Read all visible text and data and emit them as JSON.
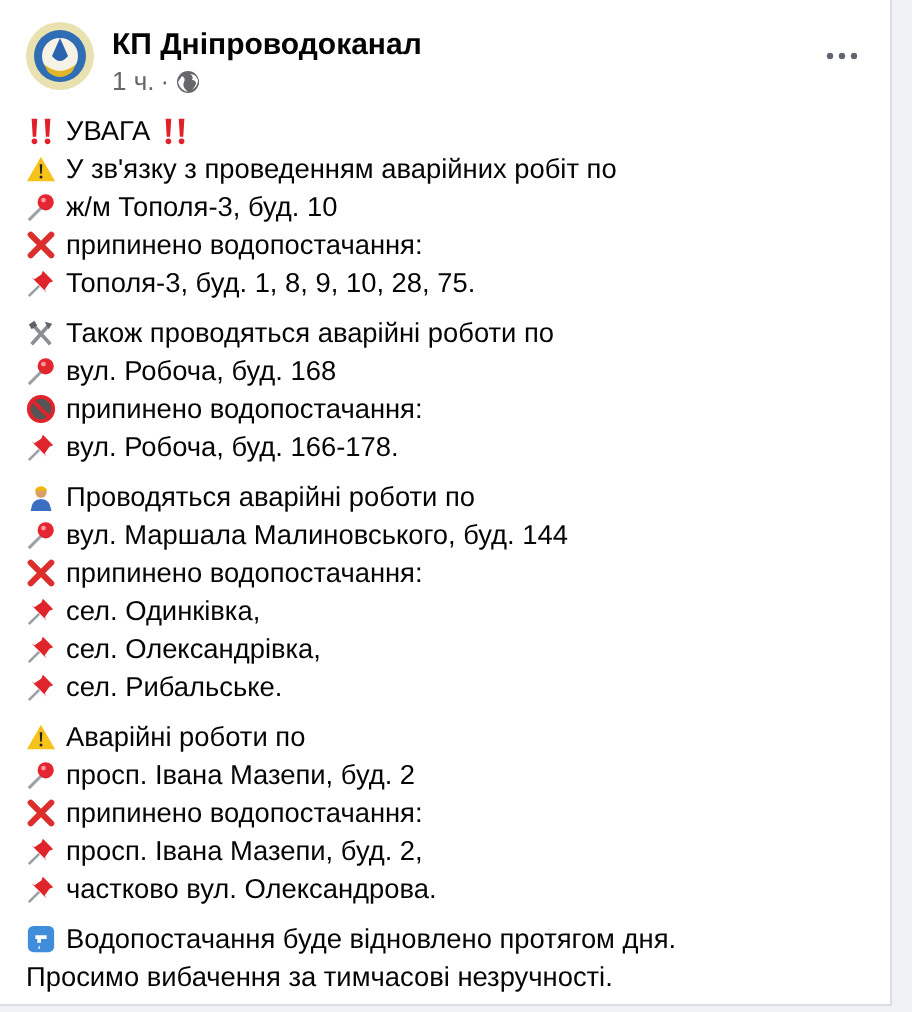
{
  "post": {
    "author": "КП Дніпроводоканал",
    "time": "1 ч.",
    "separator": "·"
  },
  "paragraphs": [
    {
      "lines": [
        {
          "kind": "alert",
          "text": "УВАГА"
        },
        {
          "kind": "warning",
          "text": "У зв'язку з проведенням аварійних робіт по"
        },
        {
          "kind": "location",
          "text": "ж/м Тополя-3, буд. 10"
        },
        {
          "kind": "stopped",
          "text": "припинено водопостачання:"
        },
        {
          "kind": "address",
          "text": "Тополя-3, буд. 1, 8, 9, 10, 28, 75."
        }
      ]
    },
    {
      "lines": [
        {
          "kind": "tools",
          "text": "Також проводяться аварійні роботи по"
        },
        {
          "kind": "location",
          "text": "вул. Робоча, буд. 168"
        },
        {
          "kind": "prohibited",
          "text": "припинено водопостачання:"
        },
        {
          "kind": "address",
          "text": "вул. Робоча, буд. 166-178."
        }
      ]
    },
    {
      "lines": [
        {
          "kind": "worker",
          "text": "Проводяться аварійні роботи по"
        },
        {
          "kind": "location",
          "text": "вул. Маршала Малиновського, буд. 144"
        },
        {
          "kind": "stopped",
          "text": "припинено водопостачання:"
        },
        {
          "kind": "address",
          "text": "сел. Одинківка,"
        },
        {
          "kind": "address",
          "text": "сел. Олександрівка,"
        },
        {
          "kind": "address",
          "text": "сел. Рибальське."
        }
      ]
    },
    {
      "lines": [
        {
          "kind": "warning",
          "text": "Аварійні роботи по"
        },
        {
          "kind": "location",
          "text": "просп. Івана Мазепи, буд. 2"
        },
        {
          "kind": "stopped",
          "text": "припинено водопостачання:"
        },
        {
          "kind": "address",
          "text": "просп. Івана Мазепи, буд. 2,"
        },
        {
          "kind": "address",
          "text": "частково вул. Олександрова."
        }
      ]
    },
    {
      "lines": [
        {
          "kind": "water",
          "text": "Водопостачання буде відновлено протягом дня."
        },
        {
          "kind": "plain",
          "text": "Просимо вибачення за тимчасові незручності."
        }
      ]
    }
  ]
}
